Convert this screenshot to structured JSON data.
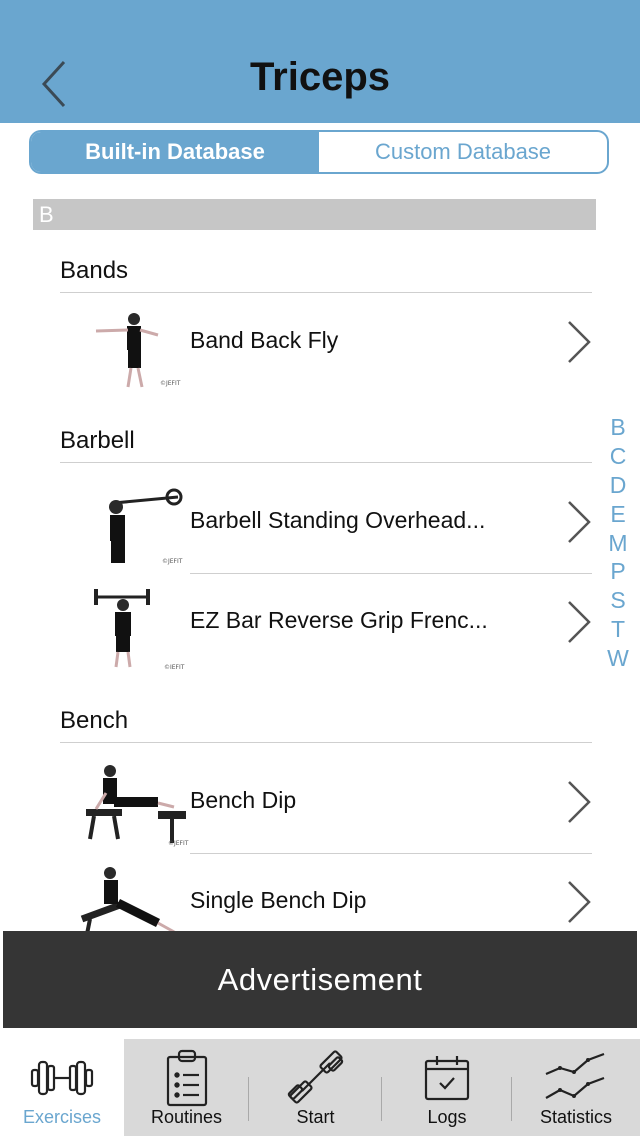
{
  "header": {
    "title": "Triceps"
  },
  "segment": {
    "builtin_label": "Built-in Database",
    "custom_label": "Custom Database"
  },
  "section_letter": "B",
  "groups": [
    {
      "title": "Bands",
      "items": [
        "Band Back Fly"
      ]
    },
    {
      "title": "Barbell",
      "items": [
        "Barbell Standing Overhead...",
        "EZ Bar Reverse Grip Frenc..."
      ]
    },
    {
      "title": "Bench",
      "items": [
        "Bench Dip",
        "Single Bench Dip"
      ]
    }
  ],
  "index_letters": [
    "B",
    "C",
    "D",
    "E",
    "M",
    "P",
    "S",
    "T",
    "W"
  ],
  "ad": {
    "label": "Advertisement"
  },
  "tabs": [
    {
      "label": "Exercises",
      "icon": "dumbbell-icon"
    },
    {
      "label": "Routines",
      "icon": "clipboard-icon"
    },
    {
      "label": "Start",
      "icon": "barbell-icon"
    },
    {
      "label": "Logs",
      "icon": "calendar-check-icon"
    },
    {
      "label": "Statistics",
      "icon": "line-graph-icon"
    }
  ],
  "colors": {
    "header": "#6aa6cf",
    "accent": "#6aa6cf",
    "ad_bg": "#353535",
    "tabbar_bg": "#d9d9d9"
  }
}
